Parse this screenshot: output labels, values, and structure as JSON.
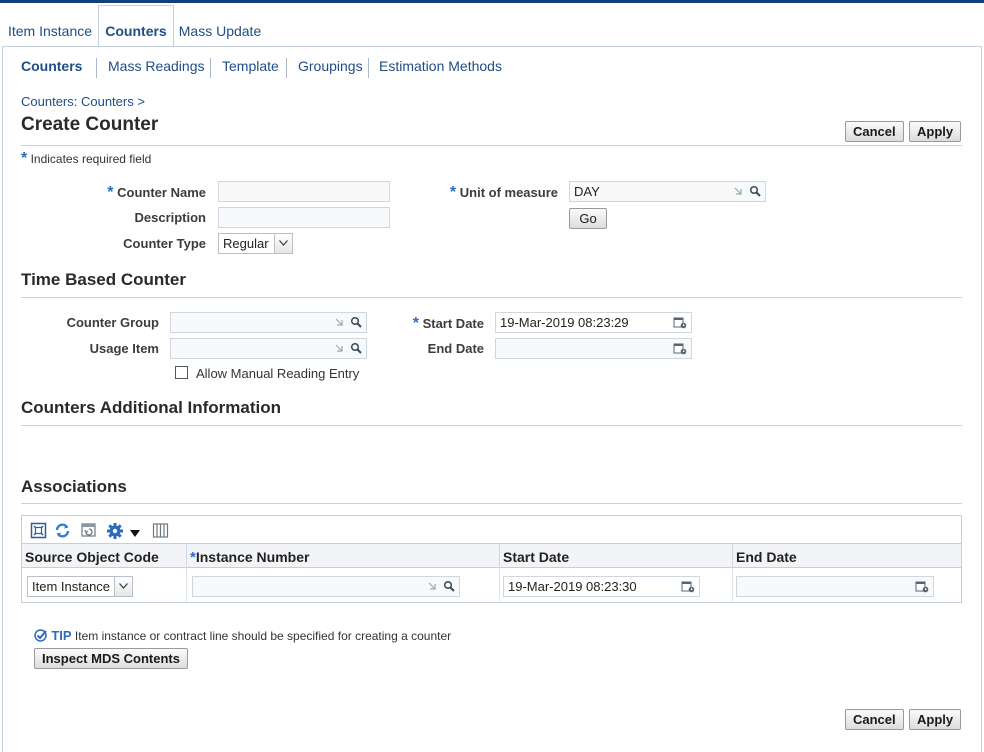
{
  "tabs": {
    "item_instance": "Item Instance",
    "counters": "Counters",
    "mass_update": "Mass Update"
  },
  "subtabs": {
    "counters": "Counters",
    "mass_readings": "Mass Readings",
    "template": "Template",
    "groupings": "Groupings",
    "estimation_methods": "Estimation Methods"
  },
  "breadcrumb": "Counters: Counters  >",
  "page_title": "Create Counter",
  "buttons": {
    "cancel": "Cancel",
    "apply": "Apply",
    "go": "Go",
    "inspect_mds": "Inspect MDS Contents"
  },
  "required_note": "Indicates required field",
  "form": {
    "counter_name_label": "Counter Name",
    "counter_name_value": "",
    "description_label": "Description",
    "description_value": "",
    "counter_type_label": "Counter Type",
    "counter_type_value": "Regular",
    "uom_label": "Unit of measure",
    "uom_value": "DAY"
  },
  "time_based": {
    "title": "Time Based Counter",
    "counter_group_label": "Counter Group",
    "counter_group_value": "",
    "usage_item_label": "Usage Item",
    "usage_item_value": "",
    "start_date_label": "Start Date",
    "start_date_value": "19-Mar-2019 08:23:29",
    "end_date_label": "End Date",
    "end_date_value": "",
    "allow_manual_label": "Allow Manual Reading Entry"
  },
  "additional_info": {
    "title": "Counters Additional Information"
  },
  "associations": {
    "title": "Associations",
    "columns": [
      "Source Object Code",
      "Instance Number",
      "Start Date",
      "End Date"
    ],
    "rows": [
      {
        "source_object_code": "Item Instance",
        "instance_number": "",
        "start_date": "19-Mar-2019 08:23:30",
        "end_date": ""
      }
    ]
  },
  "tip": {
    "label": "TIP",
    "text": "Item instance or contract line should be specified for creating a counter"
  },
  "icons": {
    "lov": "search-icon",
    "calendar": "calendar-icon",
    "detach": "detach-icon",
    "refresh": "refresh-icon",
    "gear": "gear-icon",
    "columns": "columns-icon"
  },
  "colors": {
    "link": "#1f4d88",
    "required": "#2c6bbf",
    "top_bar": "#14407a"
  }
}
